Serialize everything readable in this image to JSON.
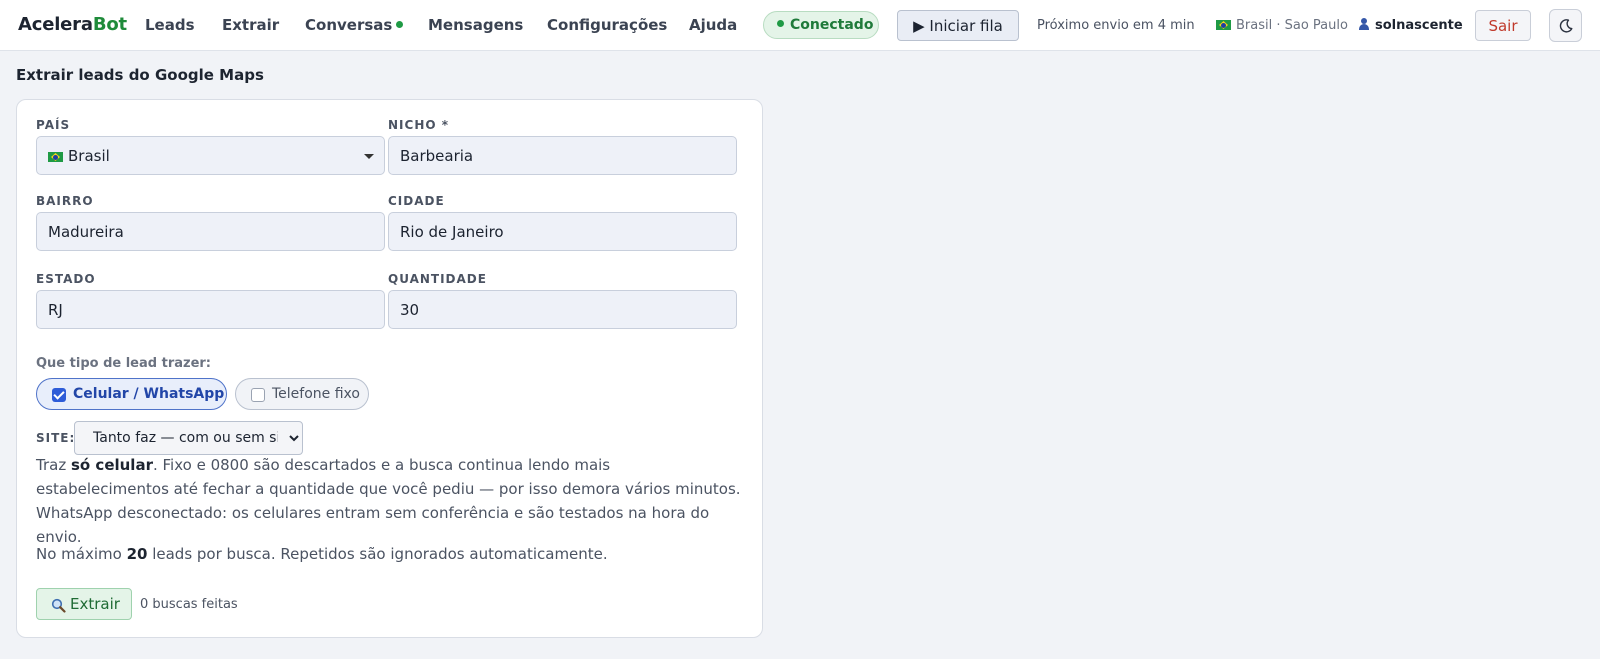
{
  "brand": {
    "part1": "Acelera",
    "part2": "Bot",
    "accent_color": "#1f8b3a"
  },
  "nav": {
    "items": [
      {
        "label": "Leads"
      },
      {
        "label": "Extrair"
      },
      {
        "label": "Conversas",
        "has_dot": true
      },
      {
        "label": "Mensagens"
      },
      {
        "label": "Configurações"
      },
      {
        "label": "Ajuda"
      }
    ]
  },
  "header": {
    "status": "Conectado",
    "queue_button": "▶ Iniciar fila",
    "next_send": "Próximo envio em 4 min",
    "locale": "Brasil · Sao Paulo",
    "username": "solnascente",
    "logout": "Sair",
    "theme_icon": "moon-icon"
  },
  "page": {
    "title": "Extrair leads do Google Maps"
  },
  "form": {
    "country": {
      "label": "PAÍS",
      "value": "Brasil"
    },
    "niche": {
      "label": "NICHO *",
      "value": "Barbearia"
    },
    "district": {
      "label": "BAIRRO",
      "value": "Madureira"
    },
    "city": {
      "label": "CIDADE",
      "value": "Rio de Janeiro"
    },
    "state": {
      "label": "ESTADO",
      "value": "RJ"
    },
    "quantity": {
      "label": "QUANTIDADE",
      "value": "30"
    },
    "lead_type": {
      "label": "Que tipo de lead trazer:",
      "options": [
        {
          "label": "Celular / WhatsApp",
          "checked": true
        },
        {
          "label": "Telefone fixo",
          "checked": false
        }
      ]
    },
    "site": {
      "label": "SITE:",
      "selected": "Tanto faz — com ou sem site"
    }
  },
  "info": {
    "line1_prefix": "Traz ",
    "line1_bold": "só celular",
    "line1_suffix": ". Fixo e 0800 são descartados e a busca continua lendo mais estabelecimentos até fechar a quantidade que você pediu — por isso demora vários minutos.",
    "line2": "WhatsApp desconectado: os celulares entram sem conferência e são testados na hora do envio.",
    "limit_prefix": "No máximo ",
    "limit_value": "20",
    "limit_suffix": " leads por busca. Repetidos são ignorados automaticamente."
  },
  "actions": {
    "extract_button": "Extrair",
    "search_count": "0 buscas feitas"
  }
}
